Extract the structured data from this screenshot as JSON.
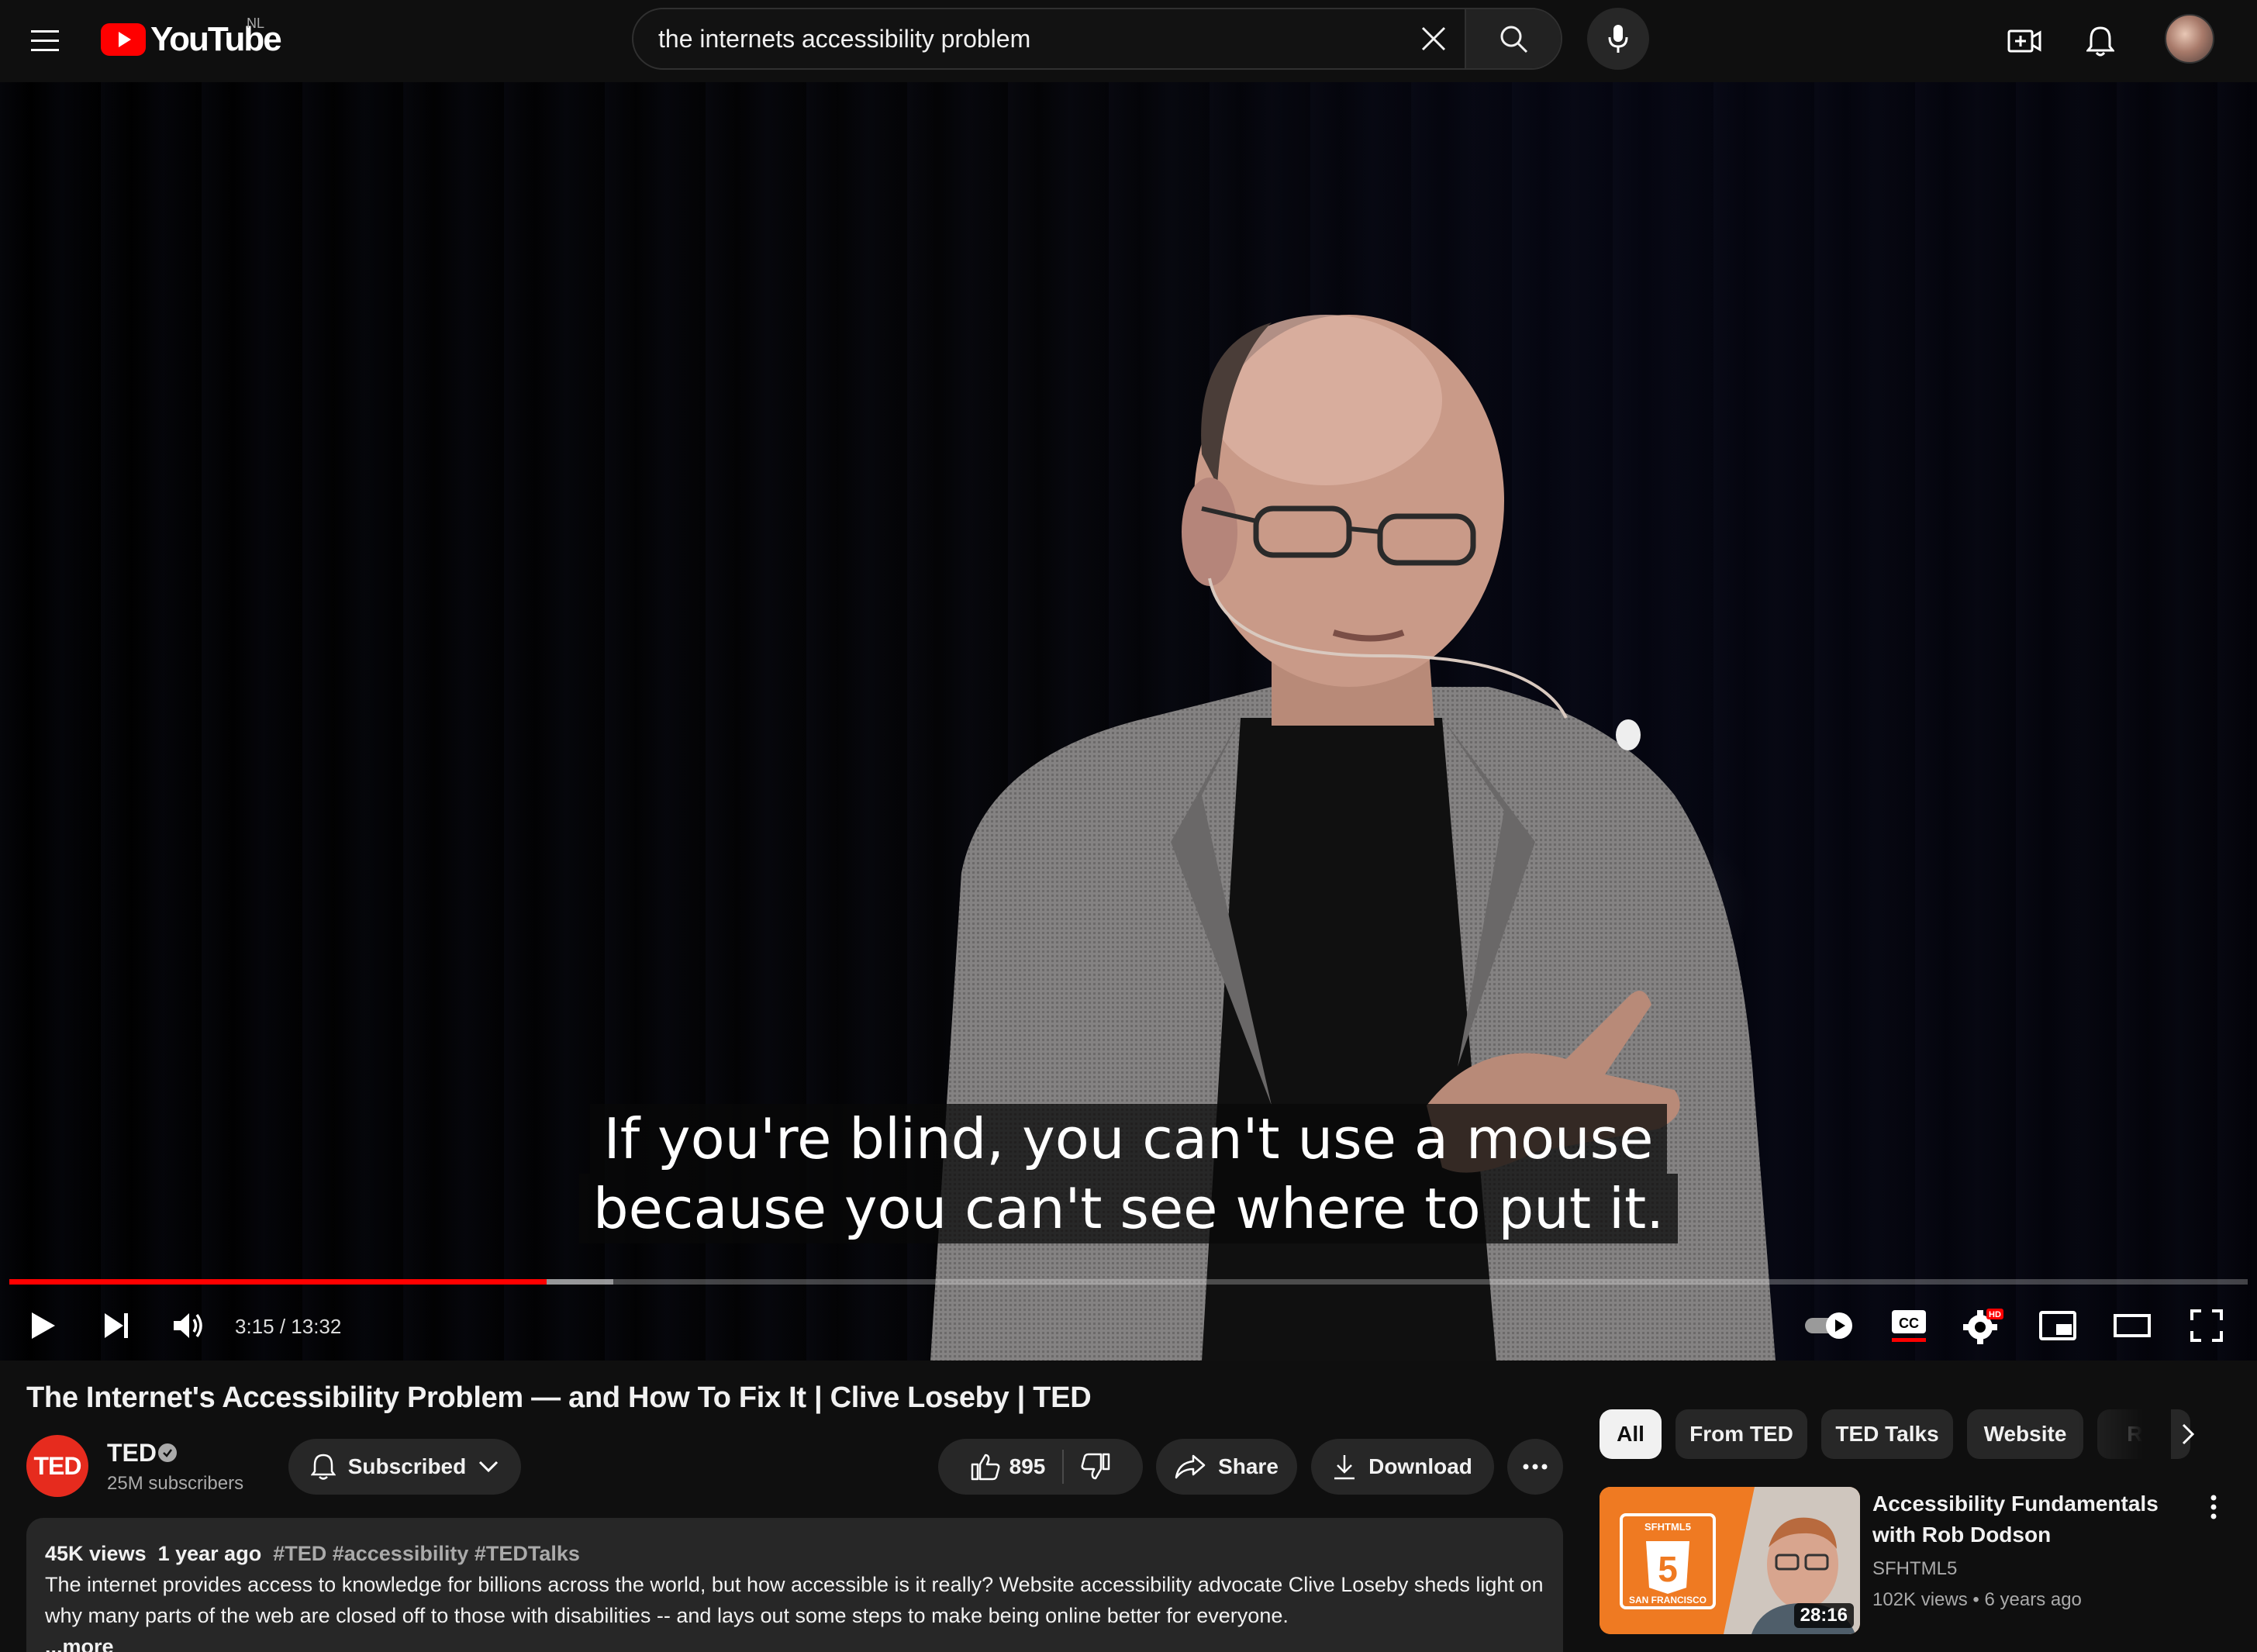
{
  "header": {
    "logo_text": "YouTube",
    "country_code": "NL",
    "search": {
      "query": "the internets accessibility problem",
      "placeholder": "Search"
    },
    "icons": [
      "menu-icon",
      "clear-icon",
      "search-icon",
      "mic-icon",
      "create-icon",
      "notifications-icon",
      "account-avatar"
    ]
  },
  "player": {
    "captions": [
      "If you're blind, you can't use a mouse",
      "because you can't see where to put it."
    ],
    "time_current": "3:15",
    "time_total": "13:32",
    "time_display": "3:15 / 13:32",
    "progress_played_fraction": 0.24,
    "progress_loaded_fraction": 0.27,
    "settings_badge": "HD",
    "accent": "#ff0000"
  },
  "video": {
    "title": "The Internet's Accessibility Problem — and How To Fix It | Clive Loseby | TED",
    "channel": {
      "name": "TED",
      "avatar_text": "TED",
      "subscribers": "25M subscribers",
      "brand_color": "#e62b1e"
    },
    "subscribe_label": "Subscribed",
    "likes": "895",
    "share_label": "Share",
    "download_label": "Download",
    "description": {
      "views": "45K views",
      "age": "1 year ago",
      "tags": "#TED #accessibility #TEDTalks",
      "text": "The internet provides access to knowledge for billions across the world, but how accessible is it really? Website accessibility advocate Clive Loseby sheds light on why many parts of the web are closed off to those with disabilities -- and lays out some steps to make being online better for everyone.",
      "more_label": "...more"
    }
  },
  "sidebar": {
    "chips": [
      "All",
      "From TED",
      "TED Talks",
      "Website",
      "Rel"
    ],
    "active_chip": "All",
    "recommendations": [
      {
        "title": "Accessibility Fundamentals with Rob Dodson",
        "channel": "SFHTML5",
        "views": "102K views",
        "age": "6 years ago",
        "duration": "28:16",
        "thumb_top_text": "SFHTML5",
        "thumb_bottom_text": "SAN FRANCISCO",
        "thumb_badge": "5"
      }
    ]
  }
}
